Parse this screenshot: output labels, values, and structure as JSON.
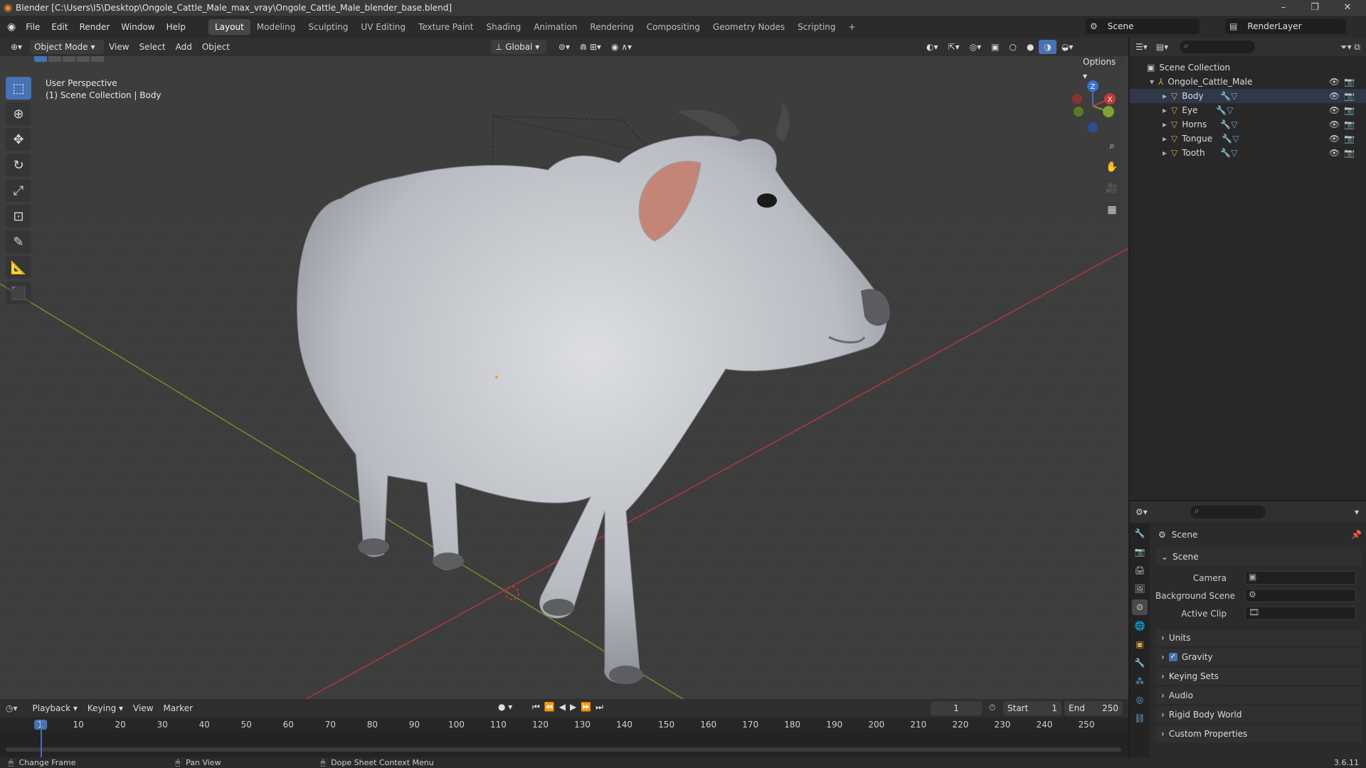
{
  "window": {
    "title": "Blender [C:\\Users\\I5\\Desktop\\Ongole_Cattle_Male_max_vray\\Ongole_Cattle_Male_blender_base.blend]",
    "minimize": "–",
    "maximize": "❐",
    "close": "✕"
  },
  "menus": [
    "File",
    "Edit",
    "Render",
    "Window",
    "Help"
  ],
  "workspaces": [
    {
      "label": "Layout",
      "active": true
    },
    {
      "label": "Modeling"
    },
    {
      "label": "Sculpting"
    },
    {
      "label": "UV Editing"
    },
    {
      "label": "Texture Paint"
    },
    {
      "label": "Shading"
    },
    {
      "label": "Animation"
    },
    {
      "label": "Rendering"
    },
    {
      "label": "Compositing"
    },
    {
      "label": "Geometry Nodes"
    },
    {
      "label": "Scripting"
    }
  ],
  "add_workspace": "+",
  "scene_selector": "Scene",
  "renderlayer_selector": "RenderLayer",
  "viewport_header": {
    "mode": "Object Mode",
    "menus": [
      "View",
      "Select",
      "Add",
      "Object"
    ],
    "transform_orientation": "Global",
    "options": "Options"
  },
  "viewport": {
    "perspective": "User Perspective",
    "collection": "(1) Scene Collection | Body"
  },
  "gizmo": {
    "z": "Z",
    "y": "Y",
    "x": "X"
  },
  "outliner": {
    "root": "Scene Collection",
    "collection": "Ongole_Cattle_Male",
    "objects": [
      "Body",
      "Eye",
      "Horns",
      "Tongue",
      "Tooth"
    ]
  },
  "properties": {
    "header": "Scene",
    "panel_scene": "Scene",
    "camera_label": "Camera",
    "background_label": "Background Scene",
    "clip_label": "Active Clip",
    "panels": [
      "Units",
      "Gravity",
      "Keying Sets",
      "Audio",
      "Rigid Body World",
      "Custom Properties"
    ],
    "gravity_checked": true
  },
  "timeline": {
    "menus": [
      "Playback",
      "Keying",
      "View",
      "Marker"
    ],
    "current_frame": "1",
    "start_label": "Start",
    "start": "1",
    "end_label": "End",
    "end": "250",
    "ticks": [
      "1",
      "10",
      "20",
      "30",
      "40",
      "50",
      "60",
      "70",
      "80",
      "90",
      "100",
      "110",
      "120",
      "130",
      "140",
      "150",
      "160",
      "170",
      "180",
      "190",
      "200",
      "210",
      "220",
      "230",
      "240",
      "250"
    ]
  },
  "status": {
    "change_frame": "Change Frame",
    "pan_view": "Pan View",
    "context_menu": "Dope Sheet Context Menu",
    "version": "3.6.11"
  },
  "colors": {
    "accent": "#4772b3",
    "x_axis": "#c23a3a",
    "y_axis": "#7fa232",
    "z_axis": "#3c6fd0"
  }
}
